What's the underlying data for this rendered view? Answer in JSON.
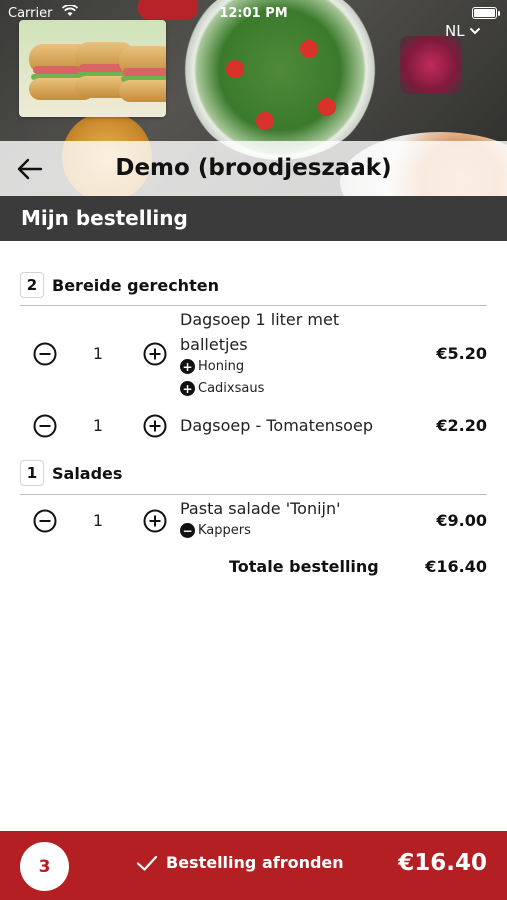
{
  "status_bar": {
    "carrier": "Carrier",
    "time": "12:01 PM"
  },
  "header": {
    "language": "NL",
    "title": "Demo (broodjeszaak)"
  },
  "section_title": "Mijn bestelling",
  "categories": [
    {
      "count": "2",
      "name": "Bereide gerechten"
    },
    {
      "count": "1",
      "name": "Salades"
    }
  ],
  "items": [
    {
      "qty": "1",
      "name_line1": "Dagsoep 1 liter met",
      "name_line2": "balletjes",
      "price": "€5.20",
      "options": [
        {
          "type": "add",
          "label": "Honing"
        },
        {
          "type": "add",
          "label": "Cadixsaus"
        }
      ]
    },
    {
      "qty": "1",
      "name_line1": "Dagsoep - Tomatensoep",
      "price": "€2.20",
      "options": []
    },
    {
      "qty": "1",
      "name_line1": "Pasta salade 'Tonijn'",
      "price": "€9.00",
      "options": [
        {
          "type": "remove",
          "label": "Kappers"
        }
      ]
    }
  ],
  "total": {
    "label": "Totale bestelling",
    "value": "€16.40"
  },
  "bottom": {
    "badge": "3",
    "checkout_label": "Bestelling afronden",
    "total": "€16.40"
  },
  "colors": {
    "accent": "#b41f24",
    "section_bar": "#3b3b3b"
  },
  "icons": {
    "back": "arrow-left-icon",
    "minus": "minus-circle-icon",
    "plus": "plus-circle-icon",
    "check": "check-icon",
    "chevron": "chevron-down-icon"
  }
}
